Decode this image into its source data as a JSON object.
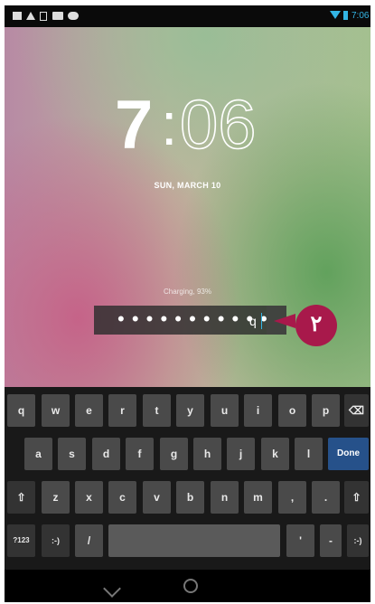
{
  "status_bar": {
    "time": "7:06",
    "icons": [
      "notification-icon",
      "warning-icon",
      "sd-card-icon",
      "photo-icon",
      "gamepad-icon",
      "wifi-icon",
      "battery-icon"
    ],
    "accent_color": "#33b5e5"
  },
  "lock_screen": {
    "clock": {
      "hour": "7",
      "separator": ":",
      "minutes": "06"
    },
    "date": "SUN, MARCH 10",
    "charging": "Charging, 93%",
    "password_field": {
      "masked_value": "• • • • • • • • • • •",
      "typed_char": "q"
    },
    "callout": {
      "label": "٢",
      "color": "#a8194b"
    }
  },
  "keyboard": {
    "row1": [
      "q",
      "w",
      "e",
      "r",
      "t",
      "y",
      "u",
      "i",
      "o",
      "p",
      "⌫"
    ],
    "row2": [
      "a",
      "s",
      "d",
      "f",
      "g",
      "h",
      "j",
      "k",
      "l",
      "Done"
    ],
    "row3": [
      "⇧",
      "z",
      "x",
      "c",
      "v",
      "b",
      "n",
      "m",
      ",",
      ".",
      "⇧"
    ],
    "row4": [
      "?123",
      ":-)",
      "/",
      "",
      "'",
      "-",
      ":-)"
    ],
    "done_color": "#26518a"
  },
  "navigation": {
    "buttons": [
      "back-icon",
      "home-icon"
    ]
  }
}
